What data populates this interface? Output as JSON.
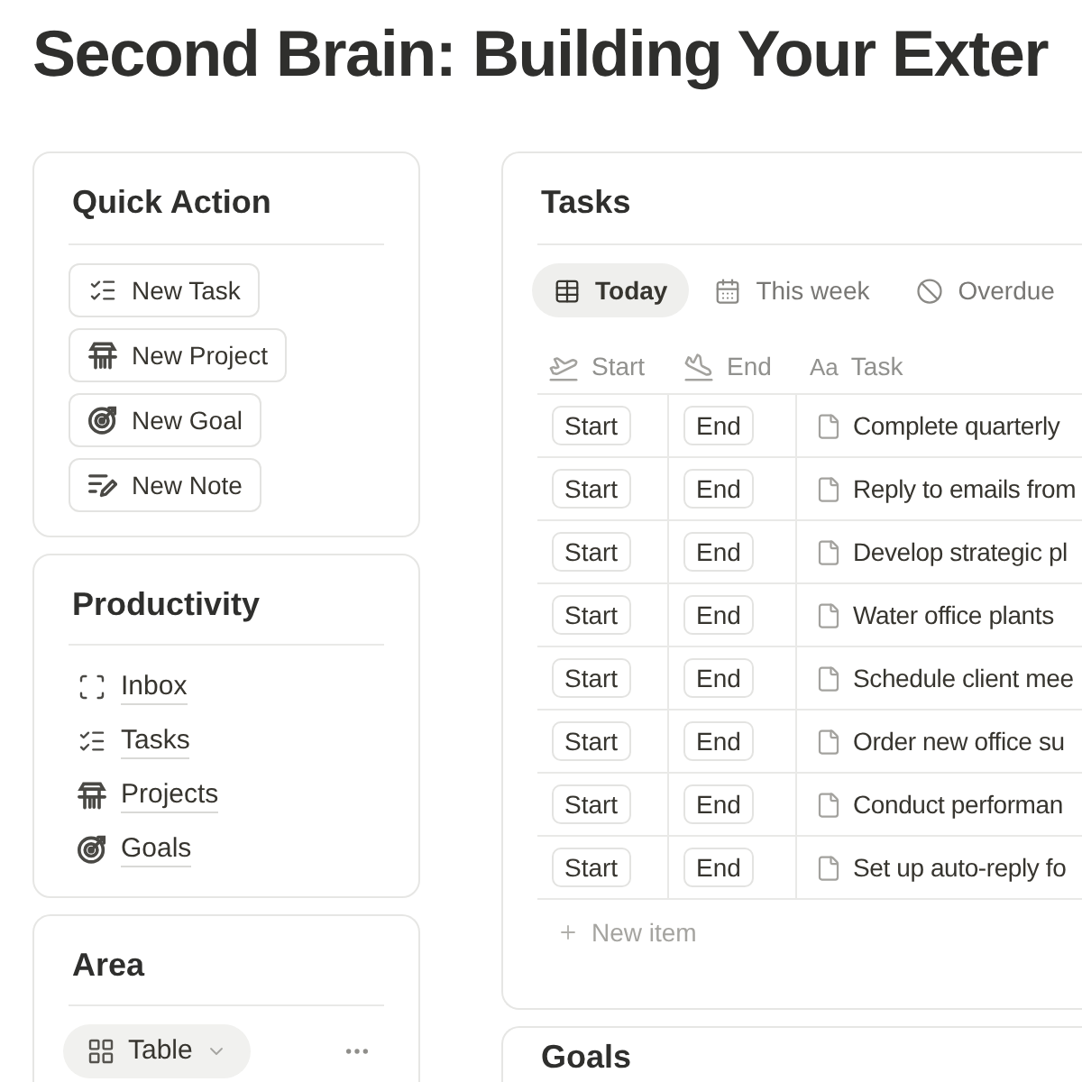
{
  "page": {
    "title": "Second Brain: Building Your Exter"
  },
  "quick_action": {
    "title": "Quick Action",
    "buttons": [
      {
        "kind": "task",
        "label": "New Task"
      },
      {
        "kind": "project",
        "label": "New Project"
      },
      {
        "kind": "goal",
        "label": "New Goal"
      },
      {
        "kind": "note",
        "label": "New Note"
      }
    ]
  },
  "productivity": {
    "title": "Productivity",
    "links": [
      {
        "kind": "inbox",
        "label": "Inbox"
      },
      {
        "kind": "task",
        "label": "Tasks"
      },
      {
        "kind": "project",
        "label": "Projects"
      },
      {
        "kind": "goal",
        "label": "Goals"
      }
    ]
  },
  "area": {
    "title": "Area",
    "view": {
      "label": "Table"
    }
  },
  "tasks": {
    "title": "Tasks",
    "tabs": [
      {
        "kind": "table",
        "label": "Today",
        "selected": true
      },
      {
        "kind": "calendar",
        "label": "This week",
        "selected": false
      },
      {
        "kind": "overdue",
        "label": "Overdue",
        "selected": false
      }
    ],
    "columns": [
      {
        "kind": "start",
        "label": "Start"
      },
      {
        "kind": "end",
        "label": "End"
      },
      {
        "kind": "title",
        "glyph": "Aa",
        "label": "Task"
      }
    ],
    "rows": [
      {
        "start": "Start",
        "end": "End",
        "task": "Complete quarterly"
      },
      {
        "start": "Start",
        "end": "End",
        "task": "Reply to emails from"
      },
      {
        "start": "Start",
        "end": "End",
        "task": "Develop strategic pl"
      },
      {
        "start": "Start",
        "end": "End",
        "task": "Water office plants"
      },
      {
        "start": "Start",
        "end": "End",
        "task": "Schedule client mee"
      },
      {
        "start": "Start",
        "end": "End",
        "task": "Order new office su"
      },
      {
        "start": "Start",
        "end": "End",
        "task": "Conduct performan"
      },
      {
        "start": "Start",
        "end": "End",
        "task": "Set up auto-reply fo"
      }
    ],
    "new_item": "New item"
  },
  "goals": {
    "title": "Goals"
  }
}
